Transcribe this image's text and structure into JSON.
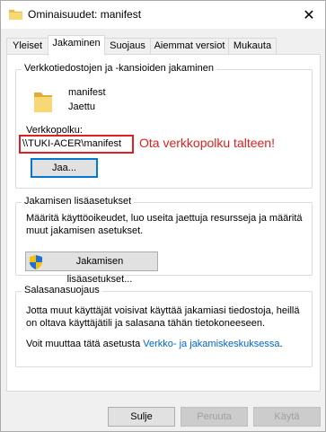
{
  "window": {
    "title": "Ominaisuudet: manifest",
    "close_glyph": "✕"
  },
  "tabs": [
    {
      "label": "Yleiset"
    },
    {
      "label": "Jakaminen",
      "active": true
    },
    {
      "label": "Suojaus"
    },
    {
      "label": "Aiemmat versiot"
    },
    {
      "label": "Mukauta"
    }
  ],
  "sharing": {
    "legend": "Verkkotiedostojen ja -kansioiden jakaminen",
    "folder_name": "manifest",
    "status": "Jaettu",
    "path_label": "Verkkopolku:",
    "path_value": "\\\\TUKI-ACER\\manifest",
    "annotation": "Ota verkkopolku talteen!",
    "share_button": "Jaa..."
  },
  "advanced": {
    "legend": "Jakamisen lisäasetukset",
    "description_line1": "Määritä käyttöoikeudet, luo useita jaettuja resursseja ja määritä",
    "description_line2": "muut jakamisen asetukset.",
    "button": "Jakamisen lisäasetukset..."
  },
  "password": {
    "legend": "Salasanasuojaus",
    "line1": "Jotta muut käyttäjät voisivat käyttää jakamiasi tiedostoja, heillä",
    "line2": "on oltava käyttäjätili ja salasana tähän tietokoneeseen.",
    "line3_prefix": "Voit muuttaa tätä asetusta",
    "link": "Verkko- ja jakamiskeskuksessa",
    "line3_suffix": "."
  },
  "footer": {
    "close": "Sulje",
    "cancel": "Peruuta",
    "apply": "Käytä"
  },
  "colors": {
    "accent": "#0078d7",
    "annotation": "#e02020",
    "link": "#0066cc",
    "folder": "#f8d775"
  }
}
